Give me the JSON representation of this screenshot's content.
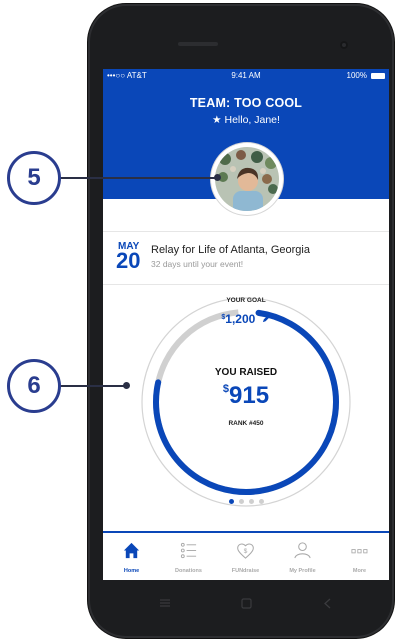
{
  "status_bar": {
    "carrier": "•••○○ AT&T",
    "time": "9:41 AM",
    "battery": "100%"
  },
  "header": {
    "team_title": "TEAM: TOO COOL",
    "greeting": "Hello, Jane!"
  },
  "event": {
    "month": "MAY",
    "day": "20",
    "name": "Relay for Life of Atlanta, Georgia",
    "countdown": "32 days until your event!"
  },
  "progress": {
    "goal_label": "YOUR GOAL",
    "goal_currency": "$",
    "goal_amount": "1,200",
    "raised_label": "YOU RAISED",
    "raised_currency": "$",
    "raised_amount": "915",
    "rank": "RANK #450",
    "goal_value": 1200,
    "raised_value": 915
  },
  "pager": {
    "count": 4,
    "active_index": 0
  },
  "tabs": [
    {
      "label": "Home",
      "icon": "home-icon",
      "active": true
    },
    {
      "label": "Donations",
      "icon": "list-icon",
      "active": false
    },
    {
      "label": "FUNdraise",
      "icon": "heart-dollar-icon",
      "active": false
    },
    {
      "label": "My Profile",
      "icon": "user-icon",
      "active": false
    },
    {
      "label": "More",
      "icon": "more-icon",
      "active": false
    }
  ],
  "callouts": [
    {
      "number": "5"
    },
    {
      "number": "6"
    }
  ],
  "colors": {
    "primary": "#0a47b8",
    "callout": "#2a3d8f"
  }
}
